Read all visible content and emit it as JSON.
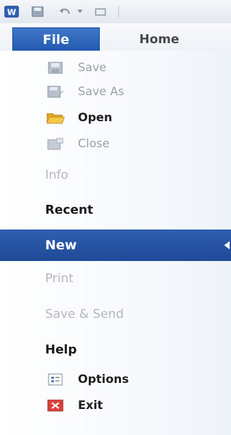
{
  "quick_access": {
    "app_icon": "word-w-icon",
    "save_icon": "save-icon",
    "undo_icon": "undo-icon",
    "dropdown_icon": "chevron-down-icon",
    "redo_icon": "redo-icon"
  },
  "tabs": {
    "file": "File",
    "home": "Home"
  },
  "commands": {
    "save": "Save",
    "save_as": "Save As",
    "open": "Open",
    "close": "Close"
  },
  "sections": {
    "info": "Info",
    "recent": "Recent",
    "new": "New",
    "print": "Print",
    "save_send": "Save & Send",
    "help": "Help"
  },
  "bottom_commands": {
    "options": "Options",
    "exit": "Exit"
  },
  "colors": {
    "accent": "#2359b0",
    "selected": "#2e5fb0",
    "disabled_text": "#b3b8bf"
  }
}
